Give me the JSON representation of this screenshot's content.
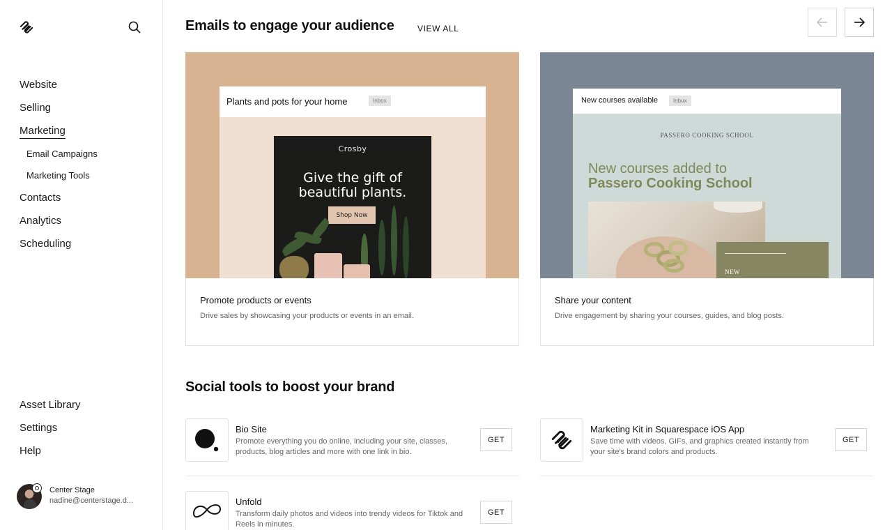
{
  "sidebar": {
    "nav": [
      {
        "label": "Website"
      },
      {
        "label": "Selling"
      },
      {
        "label": "Marketing"
      },
      {
        "label": "Contacts"
      },
      {
        "label": "Analytics"
      },
      {
        "label": "Scheduling"
      }
    ],
    "marketing_sub": [
      {
        "label": "Email Campaigns"
      },
      {
        "label": "Marketing Tools"
      }
    ],
    "bottom": [
      {
        "label": "Asset Library"
      },
      {
        "label": "Settings"
      },
      {
        "label": "Help"
      }
    ],
    "user": {
      "name": "Center Stage",
      "email": "nadine@centerstage.d..."
    }
  },
  "emails": {
    "title": "Emails to engage your audience",
    "view_all": "VIEW ALL",
    "cards": [
      {
        "title": "Promote products or events",
        "desc": "Drive sales by showcasing your products or events in an email.",
        "preview": {
          "subject": "Plants and pots for your home",
          "tag": "Inbox",
          "brand": "Crosby",
          "headline": "Give the gift of beautiful plants.",
          "button": "Shop Now"
        }
      },
      {
        "title": "Share your content",
        "desc": "Drive engagement by sharing your courses, guides, and blog posts.",
        "preview": {
          "subject": "New courses available",
          "tag": "Inbox",
          "school": "PASSERO COOKING SCHOOL",
          "headline_1": "New courses added to",
          "headline_2": "Passero Cooking School",
          "badge": "NEW"
        }
      }
    ]
  },
  "social": {
    "title": "Social tools to boost your brand",
    "tools": [
      {
        "name": "Bio Site",
        "desc": "Promote everything you do online, including your site, classes, products, blog articles and more with one link in bio.",
        "button": "GET"
      },
      {
        "name": "Marketing Kit in Squarespace iOS App",
        "desc": "Save time with videos, GIFs, and graphics created instantly from your site's brand colors and products.",
        "button": "GET"
      },
      {
        "name": "Unfold",
        "desc": "Transform daily photos and videos into trendy videos for Tiktok and Reels in minutes.",
        "button": "GET"
      }
    ]
  },
  "icons": {
    "logo": "squarespace-logo-icon",
    "search": "search-icon",
    "prev": "arrow-left-icon",
    "next": "arrow-right-icon"
  },
  "colors": {
    "card1_bg": "#d8b392",
    "card2_bg": "#7a8693",
    "accent_olive": "#7d8a5a"
  }
}
